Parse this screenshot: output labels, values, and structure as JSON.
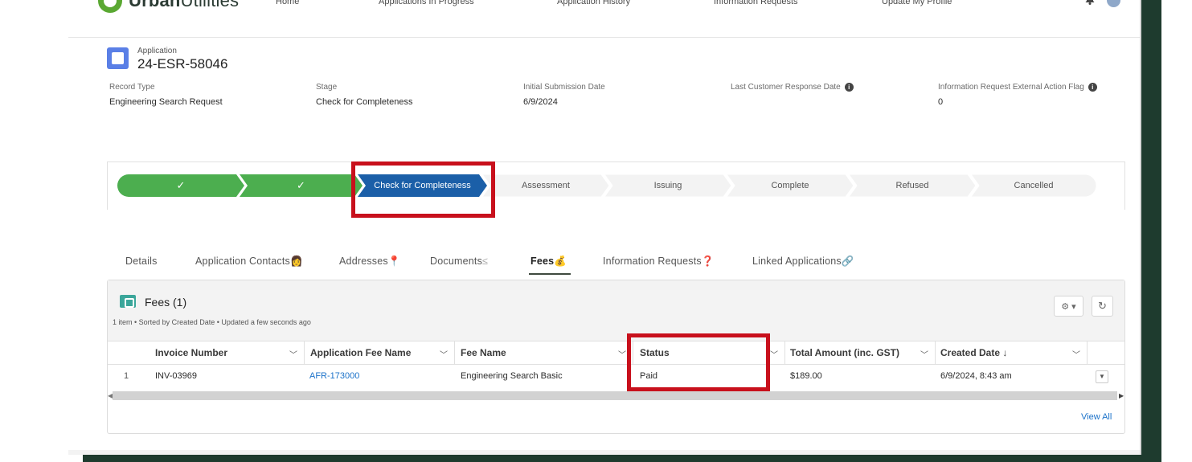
{
  "brand": {
    "name_bold": "Urban",
    "name_rest": "Utilities"
  },
  "nav": [
    "Home",
    "Applications In Progress",
    "Application History",
    "Information Requests",
    "Update My Profile"
  ],
  "icons": {
    "bell": "bell-icon",
    "user": "user-avatar-icon",
    "info": "info-icon"
  },
  "record": {
    "object_label": "Application",
    "name": "24-ESR-58046",
    "fields": [
      {
        "label": "Record Type",
        "value": "Engineering Search Request"
      },
      {
        "label": "Stage",
        "value": "Check for Completeness"
      },
      {
        "label": "Initial Submission Date",
        "value": "6/9/2024"
      },
      {
        "label": "Last Customer Response Date",
        "value": ""
      },
      {
        "label": "Information Request External Action Flag",
        "value": "0"
      }
    ]
  },
  "path": {
    "steps": [
      {
        "label": "✓",
        "state": "complete"
      },
      {
        "label": "✓",
        "state": "complete"
      },
      {
        "label": "Check for Completeness",
        "state": "current"
      },
      {
        "label": "Assessment",
        "state": "incomplete"
      },
      {
        "label": "Issuing",
        "state": "incomplete"
      },
      {
        "label": "Complete",
        "state": "incomplete"
      },
      {
        "label": "Refused",
        "state": "incomplete"
      },
      {
        "label": "Cancelled",
        "state": "incomplete"
      }
    ]
  },
  "tabs": [
    {
      "label": "Details",
      "emoji": ""
    },
    {
      "label": "Application Contacts",
      "emoji": "👩"
    },
    {
      "label": "Addresses",
      "emoji": "📍"
    },
    {
      "label": "Documents",
      "emoji": "≤"
    },
    {
      "label": "Fees",
      "emoji": "💰"
    },
    {
      "label": "Information Requests",
      "emoji": "❓"
    },
    {
      "label": "Linked Applications",
      "emoji": "🔗"
    }
  ],
  "fees": {
    "title": "Fees (1)",
    "subtitle": "1 item • Sorted by Created Date • Updated a few seconds ago",
    "settings_label": "⚙ ▾",
    "refresh_label": "↻",
    "columns": [
      "Invoice Number",
      "Application Fee Name",
      "Fee Name",
      "Status",
      "Total Amount (inc. GST)",
      "Created Date ↓"
    ],
    "rows": [
      {
        "index": "1",
        "invoice_number": "INV-03969",
        "application_fee_name": "AFR-173000",
        "fee_name": "Engineering Search Basic",
        "status": "Paid",
        "total_amount": "$189.00",
        "created_date": "6/9/2024, 8:43 am"
      }
    ],
    "view_all": "View All"
  },
  "colors": {
    "path_complete": "#4cae4f",
    "path_current": "#1b5fa8",
    "path_incomplete": "#f3f3f3",
    "highlight": "#c8101c",
    "link": "#1b72c9",
    "brand_green": "#5aa832"
  }
}
